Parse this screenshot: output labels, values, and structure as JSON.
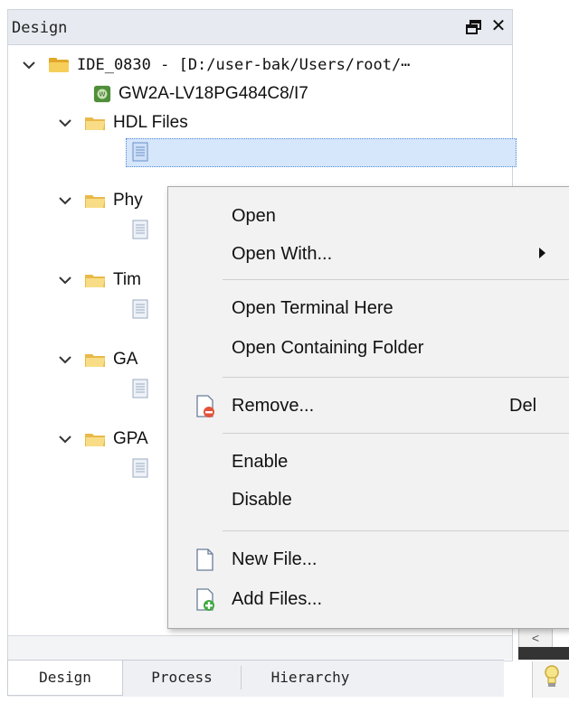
{
  "dock": {
    "title": "Design"
  },
  "tree": {
    "project": "IDE_0830 - [D:/user-bak/Users/root/⋯",
    "device": "GW2A-LV18PG484C8/I7",
    "groups": [
      {
        "label": "HDL Files"
      },
      {
        "label": "Phy"
      },
      {
        "label": "Tim"
      },
      {
        "label": "GA"
      },
      {
        "label": "GPA"
      }
    ]
  },
  "context_menu": {
    "open": "Open",
    "open_with": "Open With...",
    "open_terminal": "Open Terminal Here",
    "open_folder": "Open Containing Folder",
    "remove": "Remove...",
    "remove_shortcut": "Del",
    "enable": "Enable",
    "disable": "Disable",
    "new_file": "New File...",
    "add_files": "Add Files..."
  },
  "tabs": [
    {
      "label": "Design"
    },
    {
      "label": "Process"
    },
    {
      "label": "Hierarchy"
    }
  ],
  "icons": {
    "float": "float-window-icon",
    "close": "close-icon",
    "chevron": "chevron-down-icon",
    "folder": "folder-icon",
    "file": "document-icon",
    "chip": "device-chip-icon",
    "remove": "remove-file-icon",
    "new_file": "new-file-icon",
    "add_files": "add-files-icon",
    "bulb": "lightbulb-icon"
  },
  "colors": {
    "folder": "#f6cf5a",
    "selection": "#d6e6fb",
    "remove_badge": "#e3533b",
    "add_badge": "#3faa3f",
    "chip": "#4f8f3a"
  }
}
